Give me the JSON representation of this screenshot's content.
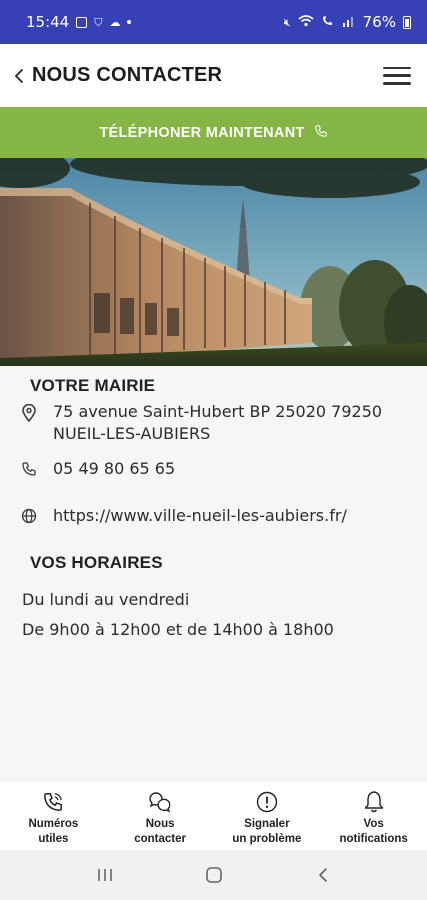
{
  "status_bar": {
    "time": "15:44",
    "battery": "76%"
  },
  "header": {
    "title": "NOUS CONTACTER"
  },
  "call_banner": {
    "label": "TÉLÉPHONER MAINTENANT"
  },
  "mairie": {
    "title": "VOTRE MAIRIE",
    "address_line1": "75 avenue Saint-Hubert BP 25020 79250",
    "address_line2": "NUEIL-LES-AUBIERS",
    "phone": "05 49 80 65 65",
    "website": "https://www.ville-nueil-les-aubiers.fr/"
  },
  "horaires": {
    "title": "VOS HORAIRES",
    "days": "Du lundi au vendredi",
    "hours": "De 9h00 à 12h00 et de 14h00 à 18h00"
  },
  "bottom_nav": {
    "items": [
      {
        "label": "Numéros\nutiles",
        "icon": "phone-icon"
      },
      {
        "label": "Nous\ncontacter",
        "icon": "chat-bubbles-icon"
      },
      {
        "label": "Signaler\nun problème",
        "icon": "alert-circle-icon"
      },
      {
        "label": "Vos\nnotifications",
        "icon": "bell-icon"
      }
    ]
  },
  "colors": {
    "status_bar": "#3741b5",
    "accent_green": "#85b545",
    "background": "#f6f6f6"
  }
}
